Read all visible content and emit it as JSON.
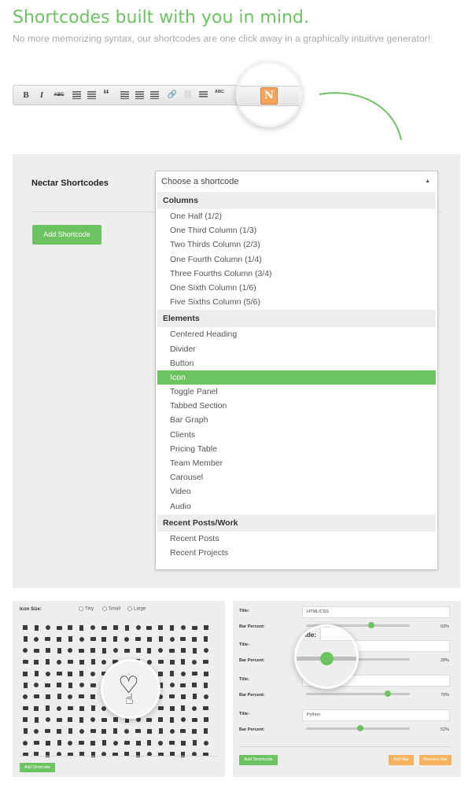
{
  "header": {
    "title": "Shortcodes built with you in mind.",
    "subtitle": "No more memorizing syntax, our shortcodes are one click away in a graphically intuitive generator!"
  },
  "toolbar": {
    "buttons": [
      {
        "glyph": "B",
        "icon": "bold-icon"
      },
      {
        "glyph": "I",
        "icon": "italic-icon"
      },
      {
        "glyph": "ABC",
        "icon": "strikethrough-icon"
      },
      {
        "glyph": "",
        "icon": "bullet-list-icon"
      },
      {
        "glyph": "",
        "icon": "numbered-list-icon"
      },
      {
        "glyph": "“",
        "icon": "blockquote-icon"
      },
      {
        "glyph": "",
        "icon": "align-left-icon"
      },
      {
        "glyph": "",
        "icon": "align-center-icon"
      },
      {
        "glyph": "",
        "icon": "align-right-icon"
      },
      {
        "glyph": "🔗",
        "icon": "link-icon"
      },
      {
        "glyph": "⛓",
        "icon": "unlink-icon"
      },
      {
        "glyph": "",
        "icon": "more-tag-icon"
      },
      {
        "glyph": "ABC",
        "icon": "spellcheck-icon"
      },
      {
        "glyph": "",
        "icon": "kitchen-sink-icon"
      }
    ],
    "nectar_button_glyph": "N",
    "accent": "#f4a35a"
  },
  "panel": {
    "label": "Nectar Shortcodes",
    "add_button": "Add Shortcode",
    "dropdown": {
      "selected": "Choose a shortcode",
      "arrow": "▲",
      "groups": [
        {
          "title": "Columns",
          "options": [
            "One Half (1/2)",
            "One Third Column (1/3)",
            "Two Thirds Column (2/3)",
            "One Fourth Column (1/4)",
            "Three Fourths Column (3/4)",
            "One Sixth Column (1/6)",
            "Five Sixths Column (5/6)"
          ]
        },
        {
          "title": "Elements",
          "options": [
            "Centered Heading",
            "Divider",
            "Button",
            "Icon",
            "Toggle Panel",
            "Tabbed Section",
            "Bar Graph",
            "Clients",
            "Pricing Table",
            "Team Member",
            "Carousel",
            "Video",
            "Audio"
          ]
        },
        {
          "title": "Recent Posts/Work",
          "options": [
            "Recent Posts",
            "Recent Projects"
          ]
        }
      ],
      "highlighted": "Icon"
    }
  },
  "icon_panel": {
    "label": "Icon Size:",
    "sizes": [
      "Tiny",
      "Small",
      "Large"
    ],
    "add_button": "Add Shortcode",
    "zoom_icons": [
      "heart-icon",
      "pointer-hand-icon"
    ]
  },
  "bar_panel": {
    "title_label": "Title:",
    "percent_label": "Bar Percent:",
    "bars": [
      {
        "title": "HTML/CSS",
        "percent": "63%",
        "value": 63
      },
      {
        "title": "",
        "percent": "28%",
        "value": 28
      },
      {
        "title": "",
        "percent": "79%",
        "value": 79
      },
      {
        "title": "Python",
        "percent": "52%",
        "value": 52
      }
    ],
    "add_button": "Add Shortcode",
    "add_bar": "Add Bar",
    "remove_bar": "Remove Bar"
  },
  "colors": {
    "accent_green": "#6cc460",
    "accent_orange": "#f6b35e"
  }
}
